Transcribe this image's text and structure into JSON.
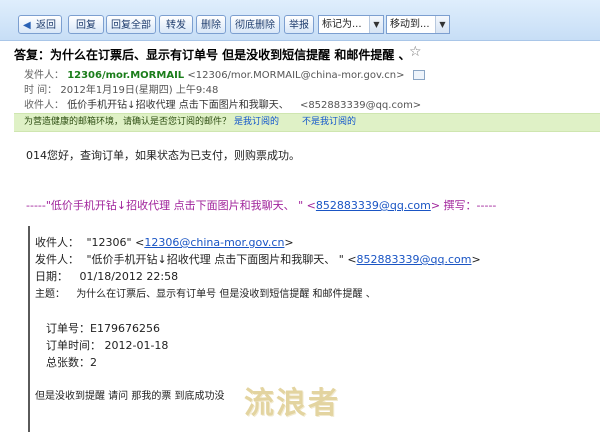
{
  "toolbar": {
    "back": "返回",
    "reply": "回复",
    "reply_all": "回复全部",
    "forward": "转发",
    "delete": "删除",
    "delete_permanent": "彻底删除",
    "report": "举报",
    "mark_as": "标记为...",
    "move_to": "移动到..."
  },
  "header": {
    "subject": "答复：为什么在订票后、显示有订单号  但是没收到短信提醒  和邮件提醒  、",
    "star_icon": "☆",
    "from_label": "发件人：",
    "from_name": "12306/mor.MORMAIL",
    "from_addr": "<12306/mor.MORMAIL@china-mor.gov.cn>",
    "time_label": "时   间：",
    "time_value": "2012年1月19日(星期四) 上午9:48",
    "to_label": "收件人：",
    "to_name": "低价手机开钻↓招收代理   点击下面图片和我聊天、",
    "to_addr": "<852883339@qq.com>"
  },
  "adbar": {
    "question": "为营造健康的邮箱环境，请确认是否您订阅的邮件？",
    "yes": "是我订阅的",
    "no": "不是我订阅的"
  },
  "body": {
    "line1": "014您好，查询订单，如果状态为已支付，则购票成功。",
    "quote_pre": "-----\"低价手机开钻↓招收代理   点击下面图片和我聊天、  \" <",
    "quote_email": "852883339@qq.com",
    "quote_post": "> 撰写：-----"
  },
  "quoted": {
    "to_label": "收件人：",
    "to_name": "\"12306\" <",
    "to_email": "12306@china-mor.gov.cn",
    "to_end": ">",
    "from_label": "发件人：",
    "from_name": "\"低价手机开钻↓招收代理   点击下面图片和我聊天、  \" <",
    "from_email": "852883339@qq.com",
    "from_end": ">",
    "date_label": "日期：",
    "date_value": "01/18/2012 22:58",
    "subject_label": "主题：",
    "subject_value": "为什么在订票后、显示有订单号  但是没收到短信提醒  和邮件提醒  、",
    "order_no": "订单号：E179676256",
    "order_time": "订单时间：   2012-01-18",
    "total": "总张数：2",
    "closing": "但是没收到提醒  请问  那我的票  到底成功没"
  },
  "watermark": "流浪者",
  "colors": {
    "accent": "#1a55c4",
    "adbar_bg": "#dff1c6",
    "quote_purple": "#a0239b",
    "sender_green": "#1a7d1a"
  }
}
